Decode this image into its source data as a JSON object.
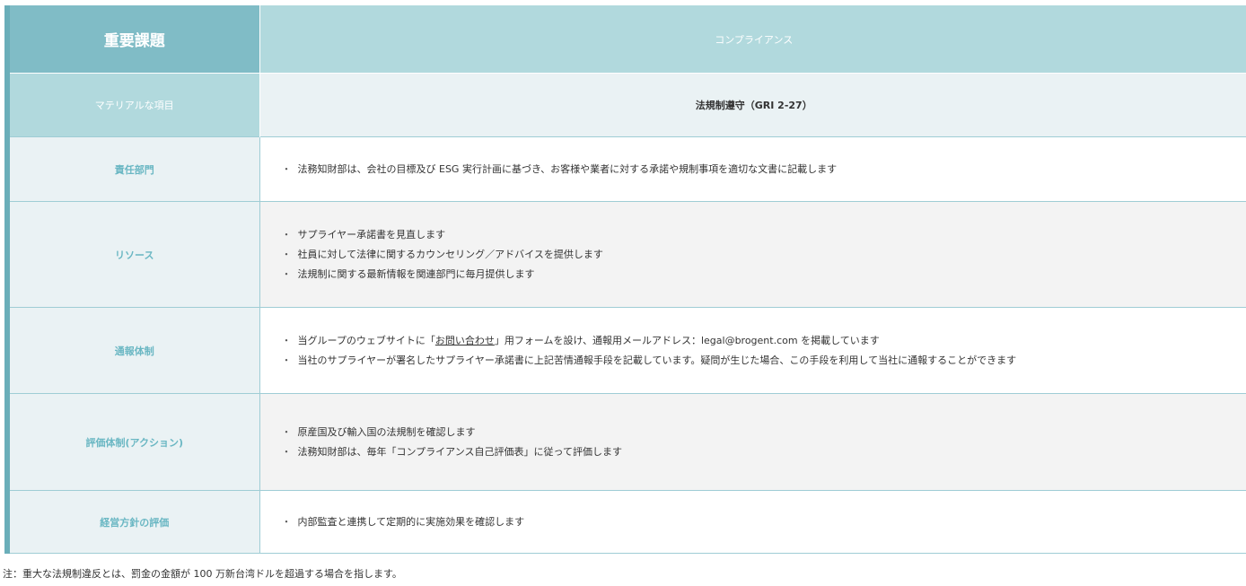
{
  "header": {
    "label": "重要課題",
    "value": "コンプライアンス"
  },
  "material": {
    "label": "マテリアルな項目",
    "value": "法規制遵守（GRI 2-27）"
  },
  "rows": [
    {
      "label": "責任部門",
      "items": [
        "法務知財部は、会社の目標及び ESG 実行計画に基づき、お客様や業者に対する承諾や規制事項を適切な文書に記載します"
      ]
    },
    {
      "label": "リソース",
      "items": [
        "サプライヤー承諾書を見直します",
        "社員に対して法律に関するカウンセリング／アドバイスを提供します",
        "法規制に関する最新情報を関連部門に毎月提供します"
      ]
    },
    {
      "label": "通報体制",
      "item1": {
        "before": "当グループのウェブサイトに「",
        "link": "お問い合わせ",
        "after": "」用フォームを設け、通報用メールアドレス：legal@brogent.com を掲載しています"
      },
      "item2": "当社のサプライヤーが署名したサプライヤー承諾書に上記苦情通報手段を記載しています。疑問が生じた場合、この手段を利用して当社に通報することができます"
    },
    {
      "label": "評価体制(アクション)",
      "items": [
        "原産国及び輸入国の法規制を確認します",
        "法務知財部は、毎年「コンプライアンス自己評価表」に従って評価します"
      ]
    },
    {
      "label": "経営方針の評価",
      "items": [
        "内部監査と連携して定期的に実施効果を確認します"
      ]
    }
  ],
  "footnote": "注：重大な法規制違反とは、罰金の金額が 100 万新台湾ドルを超過する場合を指します。"
}
